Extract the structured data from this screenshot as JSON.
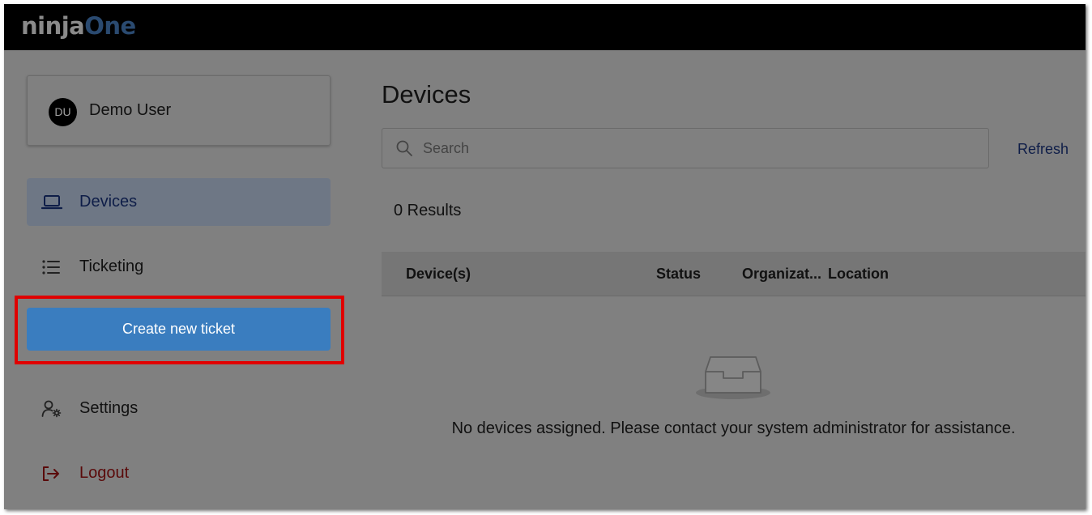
{
  "brand": {
    "logo_part1": "ninja",
    "logo_part2": "One"
  },
  "user": {
    "initials": "DU",
    "name": "Demo User"
  },
  "sidebar": {
    "items": [
      {
        "label": "Devices",
        "icon": "laptop-icon",
        "active": true
      },
      {
        "label": "Ticketing",
        "icon": "list-icon"
      },
      {
        "label": "Settings",
        "icon": "user-gear-icon"
      },
      {
        "label": "Logout",
        "icon": "logout-icon"
      }
    ],
    "create_ticket_label": "Create new ticket"
  },
  "main": {
    "title": "Devices",
    "search": {
      "placeholder": "Search",
      "value": ""
    },
    "refresh_label": "Refresh",
    "results_text": "0 Results",
    "table": {
      "columns": [
        "Device(s)",
        "Status",
        "Organizat...",
        "Location"
      ],
      "rows": []
    },
    "empty_message": "No devices assigned. Please contact your system administrator for assistance."
  },
  "colors": {
    "overlay": "#808080",
    "topbar": "#000000",
    "active_nav": "#6e7785",
    "primary_button": "#3a7dbf",
    "highlight": "#e00000",
    "logout": "#5a0a0a"
  }
}
